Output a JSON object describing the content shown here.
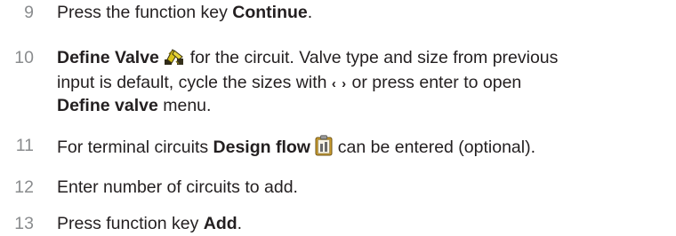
{
  "steps": [
    {
      "number": "9",
      "text_before": "Press the function key ",
      "bold": "Continue",
      "text_after": "."
    },
    {
      "number": "10",
      "bold": "Define Valve",
      "text_after_icon": " for the circuit. Valve type and size from previous",
      "line2_before": "input is default, cycle the sizes with ",
      "arrows": "‹ ›",
      "line2_after": " or press enter to open",
      "line3_bold": "Define valve",
      "line3_after": " menu.",
      "icon": "valve-icon"
    },
    {
      "number": "11",
      "text_before": "For terminal circuits ",
      "bold": "Design flow",
      "text_after": " can be entered (optional).",
      "icon": "clipboard-icon"
    },
    {
      "number": "12",
      "text": "Enter number of circuits to add."
    },
    {
      "number": "13",
      "text_before": "Press function key ",
      "bold": "Add",
      "text_after": "."
    }
  ]
}
